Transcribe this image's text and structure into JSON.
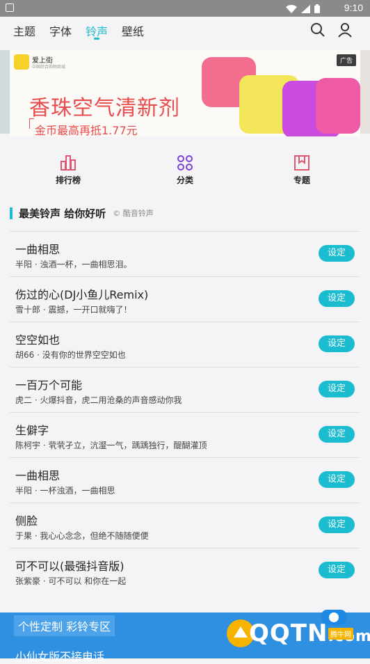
{
  "status": {
    "time": "9:10"
  },
  "nav": {
    "tabs": [
      {
        "label": "主题"
      },
      {
        "label": "字体"
      },
      {
        "label": "铃声"
      },
      {
        "label": "壁纸"
      }
    ],
    "active_tab": "铃声"
  },
  "banner": {
    "brand": "爱上街",
    "brand_sub": "中国综合购物商城",
    "headline": "香珠空气清新剂",
    "subline": "金币最高再抵1.77元",
    "ad_tag": "广告"
  },
  "quick": [
    {
      "label": "排行榜",
      "icon": "chart-icon"
    },
    {
      "label": "分类",
      "icon": "category-icon"
    },
    {
      "label": "专题",
      "icon": "bookmark-icon"
    }
  ],
  "section": {
    "title": "最美铃声 给你好听",
    "copyright": "© 酷音铃声"
  },
  "ringtones": [
    {
      "title": "一曲相思",
      "sub": "半阳 · 浊酒一杯，一曲相思泪。",
      "button": "设定"
    },
    {
      "title": "伤过的心(DJ小鱼儿Remix)",
      "sub": "雪十郎 · 震撼，一开口就嗨了！",
      "button": "设定"
    },
    {
      "title": "空空如也",
      "sub": "胡66 · 没有你的世界空空如也",
      "button": "设定"
    },
    {
      "title": "一百万个可能",
      "sub": "虎二 · 火爆抖音，虎二用沧桑的声音感动你我",
      "button": "设定"
    },
    {
      "title": "生僻字",
      "sub": "陈柯宇 · 茕茕孑立，沆瀣一气，踽踽独行，醍醐灌顶",
      "button": "设定"
    },
    {
      "title": "一曲相思",
      "sub": "半阳 · 一杯浊酒，一曲相思",
      "button": "设定"
    },
    {
      "title": "侧脸",
      "sub": "于果 · 我心心念念，但绝不随随便便",
      "button": "设定"
    },
    {
      "title": "可不可以(最强抖音版)",
      "sub": "张紫豪 · 可不可以 和你在一起",
      "button": "设定"
    }
  ],
  "footer": {
    "promo": "个性定制 彩铃专区",
    "promo2": "小仙女版不接电话"
  },
  "watermark": {
    "text": "QQTN",
    "suffix": ".com",
    "cn": "腾牛网"
  },
  "colors": {
    "accent": "#1bbcd0",
    "footer_bg": "#2f8fe0",
    "banner_red": "#e84b4b"
  }
}
